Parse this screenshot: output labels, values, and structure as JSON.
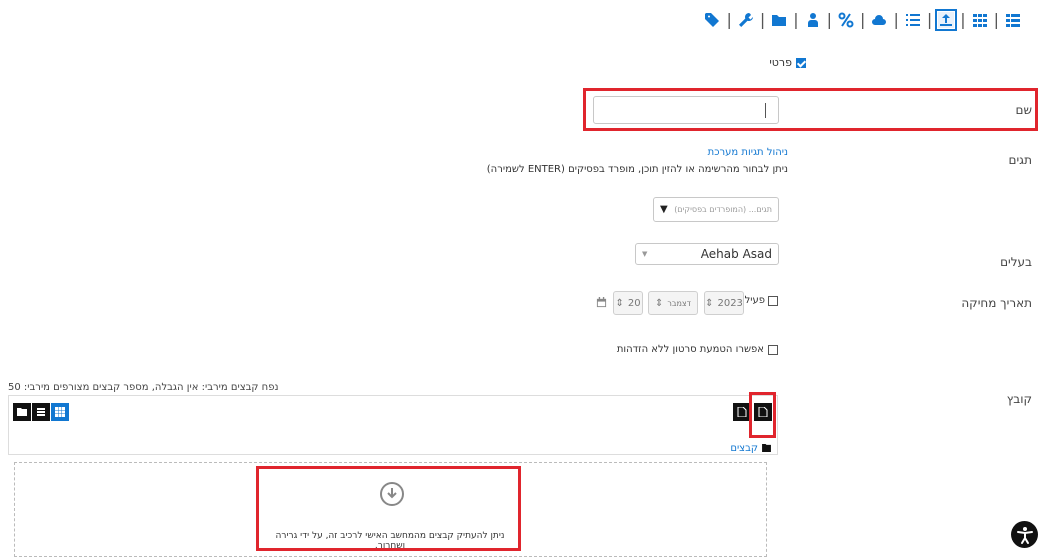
{
  "toolbar": {
    "icons": [
      "tag-icon",
      "wrench-icon",
      "folder-icon",
      "user-icon",
      "link-icon",
      "cloud-icon",
      "list-icon",
      "upload-icon",
      "grid-icon",
      "list-view-icon"
    ]
  },
  "private": {
    "label": "פרטי",
    "checked": true
  },
  "name": {
    "label": "שם",
    "value": ""
  },
  "tags": {
    "label": "תגים",
    "manage_link": "ניהול תגיות מערכת",
    "help": "ניתן לבחור מהרשימה או להזין תוכן, מופרד בפסיקים (ENTER לשמירה)",
    "placeholder": "תגים... (המופרדים בפסיקים)"
  },
  "owner": {
    "label": "בעלים",
    "value": "Aehab Asad"
  },
  "delete_date": {
    "label": "תאריך מחיקה",
    "enable_label": "פעיל",
    "year": "2023",
    "month": "דצמבר",
    "day": "20"
  },
  "anonymous": {
    "label": "אפשרו הטמעת סרטון ללא הזדהות"
  },
  "file": {
    "label": "קובץ",
    "limits": "נפח קבצים מירבי: אין הגבלה, מספר קבצים מצורפים מירבי: 50",
    "breadcrumb": "קבצים",
    "drop_text": "ניתן להעתיק קבצים מהמחשב האישי לרכיב זה, על ידי גרירה ושחרור."
  },
  "colors": {
    "accent": "#1177d1",
    "highlight": "#e0252d"
  }
}
